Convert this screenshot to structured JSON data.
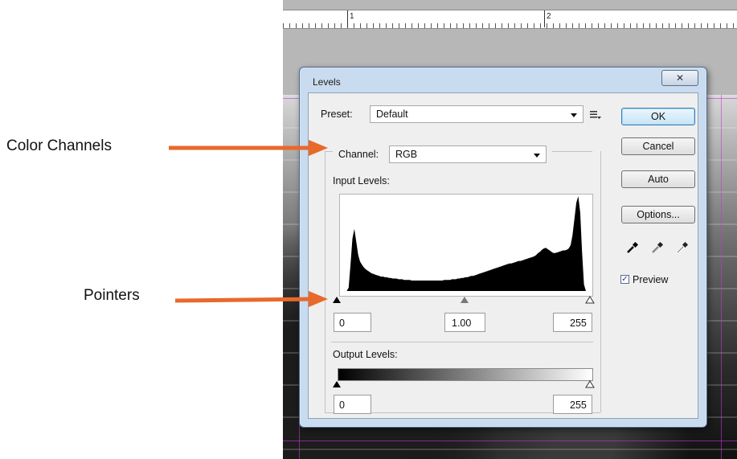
{
  "annotations": {
    "color_channels": "Color Channels",
    "pointers": "Pointers",
    "arrow_color": "#e8692a"
  },
  "ruler": {
    "labels": [
      "1",
      "2"
    ]
  },
  "dialog": {
    "title": "Levels",
    "close_glyph": "✕",
    "preset_label": "Preset:",
    "preset_value": "Default",
    "channel_label": "Channel:",
    "channel_value": "RGB",
    "input_levels_label": "Input Levels:",
    "input_black": "0",
    "input_gamma": "1.00",
    "input_white": "255",
    "output_levels_label": "Output Levels:",
    "output_black": "0",
    "output_white": "255",
    "buttons": {
      "ok": "OK",
      "cancel": "Cancel",
      "auto": "Auto",
      "options": "Options..."
    },
    "preview_label": "Preview",
    "preview_checked": true,
    "icons": [
      "preset-menu-icon",
      "black-eyedropper-icon",
      "gray-eyedropper-icon",
      "white-eyedropper-icon"
    ]
  },
  "histogram": [
    0,
    0,
    5,
    40,
    80,
    95,
    75,
    55,
    45,
    40,
    36,
    33,
    31,
    29,
    27,
    26,
    25,
    24,
    23,
    22,
    22,
    21,
    21,
    20,
    20,
    19,
    19,
    19,
    18,
    18,
    18,
    17,
    17,
    17,
    17,
    16,
    16,
    16,
    16,
    16,
    16,
    16,
    16,
    16,
    16,
    16,
    16,
    16,
    16,
    16,
    16,
    16,
    17,
    17,
    17,
    17,
    18,
    18,
    18,
    19,
    19,
    20,
    20,
    21,
    21,
    22,
    23,
    23,
    24,
    25,
    26,
    27,
    28,
    29,
    30,
    31,
    32,
    33,
    34,
    35,
    36,
    37,
    38,
    39,
    40,
    41,
    42,
    42,
    43,
    44,
    45,
    46,
    46,
    47,
    48,
    49,
    50,
    51,
    52,
    53,
    55,
    58,
    60,
    63,
    65,
    66,
    64,
    62,
    60,
    58,
    58,
    59,
    60,
    61,
    62,
    62,
    63,
    65,
    70,
    85,
    110,
    135,
    145,
    120,
    60,
    10,
    0
  ]
}
